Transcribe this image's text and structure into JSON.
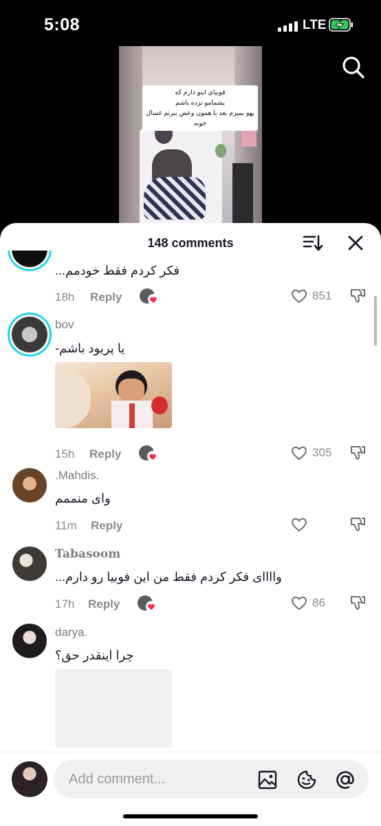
{
  "status_bar": {
    "time": "5:08",
    "network": "LTE",
    "battery_state": "charging"
  },
  "video": {
    "caption_lines": [
      "فوبیای اینو دارم که",
      "پشمامو نزده باشم",
      "یهو بمیرم بعد با همون وعض ببرنم غسال خونه"
    ],
    "search_icon": "search-icon"
  },
  "sheet": {
    "comments_count": "148 comments",
    "sort_icon": "sort-icon",
    "close_icon": "close-icon"
  },
  "comments": [
    {
      "username": "",
      "text": "فکر کردم فقط خودمم...",
      "time": "18h",
      "reply": "Reply",
      "creator_liked": true,
      "likes": "851",
      "avatar_ring": true
    },
    {
      "username": "bov",
      "text": "یا پریود باشم-",
      "time": "15h",
      "reply": "Reply",
      "creator_liked": true,
      "likes": "305",
      "avatar_ring": true,
      "has_image": true
    },
    {
      "username": ".Mahdis.",
      "text": "وای منممم",
      "time": "11m",
      "reply": "Reply",
      "creator_liked": false,
      "likes": ""
    },
    {
      "username": "Tabasoom",
      "text": "واااای فکر کردم فقط من این فوبیا رو دارم...",
      "time": "17h",
      "reply": "Reply",
      "creator_liked": true,
      "likes": "86"
    },
    {
      "username": "darya.",
      "text": "چرا اینقدر حق؟",
      "has_image": true
    }
  ],
  "composer": {
    "placeholder": "Add comment..."
  },
  "colors": {
    "accent_ring": "#20d5ec",
    "creator_heart": "#fe2c55",
    "text": "#161823",
    "muted": "#8a8b91"
  }
}
